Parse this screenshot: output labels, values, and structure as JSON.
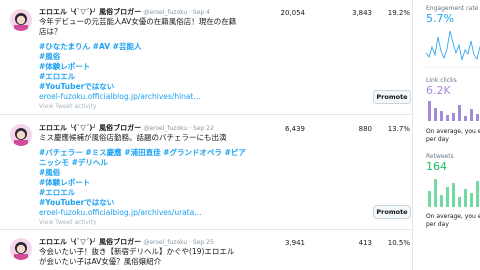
{
  "tweets": [
    {
      "name": "エロエル ╰(ˋ▽ˊ)╯ 風俗ブロガー",
      "handle": "@eroel_fuzoku · Sep 4",
      "lines": [
        "今年デビューの元芸能人AV女優の在籍風俗店！現在の在籍",
        "店は？"
      ],
      "tags": [
        "#ひなたまりん #AV #芸能人",
        "#風俗",
        "#体験レポート",
        "#エロエル",
        "#YouTuberではない"
      ],
      "link": "eroel-fuzoku.officialblog.jp/archives/hinat…",
      "activity": "View Tweet activity",
      "impressions": "20,054",
      "engagements": "3,843",
      "rate": "19.2%",
      "promote": "Promote"
    },
    {
      "name": "エロエル ╰(ˋ▽ˊ)╯ 風俗ブロガー",
      "handle": "@eroel_fuzoku · Sep 22",
      "lines": [
        "ミス慶應候補が風俗店勤務。話題のバチェラーにも出演"
      ],
      "tags": [
        "#バチェラー #ミス慶應 #浦田直佳 #グランドオペラ #ピア",
        "ニッシモ #デリヘル",
        "#風俗",
        "#体験レポート",
        "#エロエル",
        "#YouTuberではない"
      ],
      "link": "eroel-fuzoku.officialblog.jp/archives/urata…",
      "activity": "View Tweet activity",
      "impressions": "6,439",
      "engagements": "880",
      "rate": "13.7%",
      "promote": "Promote"
    },
    {
      "name": "エロエル ╰(ˋ▽ˊ)╯ 風俗ブロガー",
      "handle": "@eroel_fuzoku · Sep 25",
      "lines": [
        "今会いたい子！抜き【新宿デリヘル】かぐや(19)エロエル",
        "が会いたい子はAV女優？風俗嬢紹介"
      ],
      "impressions": "3,941",
      "engagements": "413",
      "rate": "10.5%"
    }
  ],
  "sidebar": {
    "engagement_title": "Engagement rate",
    "engagement_value": "5.7%",
    "link_title": "Link clicks",
    "link_value": "6.2K",
    "link_note": [
      "On average, you ear",
      "per day"
    ],
    "retweet_title": "Retweets",
    "retweet_value": "164",
    "retweet_note": [
      "On average, you ear",
      "per day"
    ],
    "colors": {
      "blue": "#1da1f2",
      "purple": "#a48bd8",
      "green": "#17bf63"
    }
  }
}
